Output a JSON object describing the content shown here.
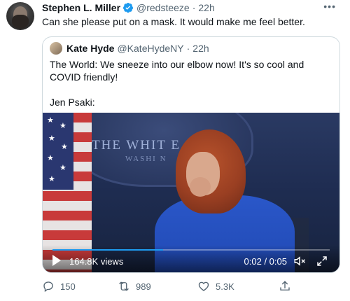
{
  "tweet": {
    "author_name": "Stephen L. Miller",
    "author_handle": "@redsteeze",
    "time": "22h",
    "text": "Can she please put on a mask. It would make me feel better.",
    "more_icon": "ellipsis-icon"
  },
  "quoted": {
    "author_name": "Kate Hyde",
    "author_handle": "@KateHydeNY",
    "time": "22h",
    "line1": "The World: We sneeze into our elbow now! It's so cool and COVID friendly!",
    "line2": "Jen Psaki:"
  },
  "video": {
    "views": "164.8K views",
    "time": "0:02 / 0:05",
    "progress": 0.4,
    "backdrop_line1": "THE WHIT      E",
    "backdrop_line2": "WASHI        N"
  },
  "actions": {
    "replies": "150",
    "retweets": "989",
    "likes": "5.3K"
  },
  "colors": {
    "accent": "#1d9bf0",
    "muted": "#536471"
  }
}
